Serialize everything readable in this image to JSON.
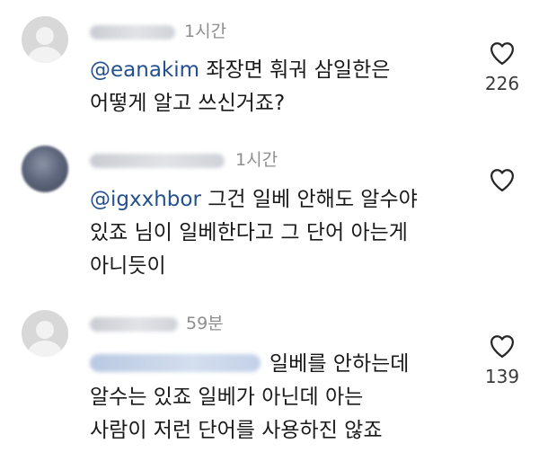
{
  "comments": [
    {
      "time": "1시간",
      "mention": "@eanakim",
      "line1_rest": " 좌장면 훠궈 삼일한은",
      "line2": "어떻게 알고 쓰신거죠?",
      "likes": "226"
    },
    {
      "time": "1시간",
      "mention": "@igxxhbor",
      "line1_rest": " 그건 일베 안해도 알수야",
      "line2": "있죠 님이 일베한다고 그 단어 아는게",
      "line3": "아니듯이",
      "likes": ""
    },
    {
      "time": "59분",
      "line1_rest": "일베를 안하는데",
      "line2": "알수는 있죠 일베가 아닌데 아는",
      "line3": "사람이 저런 단어를 사용하진 않죠",
      "likes": "139"
    }
  ],
  "icons": {
    "avatar": "default-avatar-icon",
    "like": "heart-outline-icon"
  }
}
